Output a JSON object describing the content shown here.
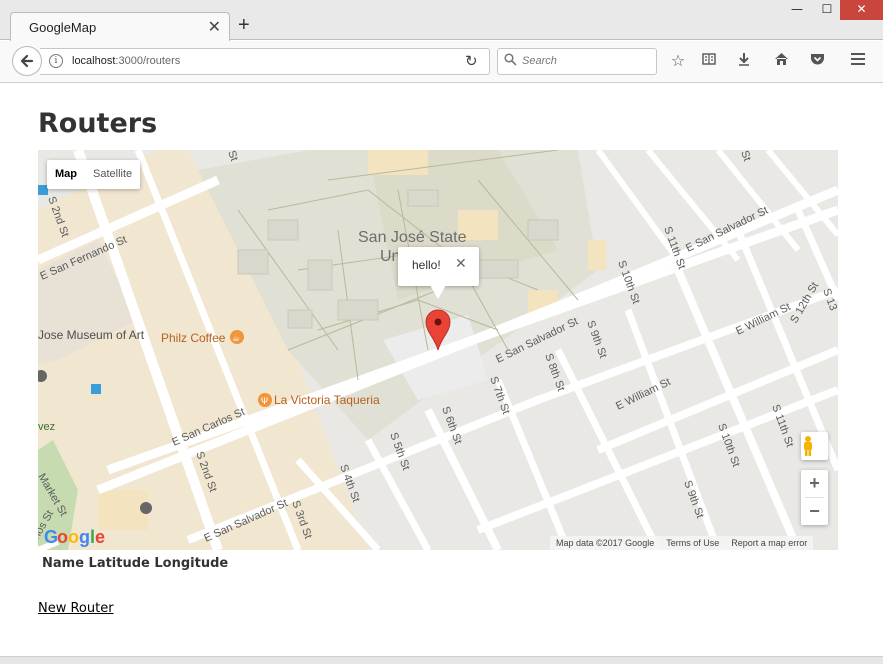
{
  "browser": {
    "tab_title": "GoogleMap",
    "tab_close": "✕",
    "new_tab": "+",
    "url_host": "localhost",
    "url_path": ":3000/routers",
    "search_placeholder": "Search",
    "window_controls": {
      "minimize": "—",
      "maximize": "☐",
      "close": "✕"
    }
  },
  "page": {
    "title": "Routers",
    "table_headers": [
      "Name",
      "Latitude",
      "Longitude"
    ],
    "table_header_text": "Name Latitude Longitude",
    "new_link": "New Router"
  },
  "map": {
    "type_buttons": [
      {
        "label": "Map",
        "active": true
      },
      {
        "label": "Satellite",
        "active": false
      }
    ],
    "info_window": {
      "text": "hello!",
      "close": "✕"
    },
    "zoom": {
      "in": "+",
      "out": "−"
    },
    "attribution": [
      "Map data ©2017 Google",
      "Terms of Use",
      "Report a map error"
    ],
    "google_logo": [
      "G",
      "o",
      "o",
      "g",
      "l",
      "e"
    ],
    "labels": {
      "university": "San José State",
      "university_2": "Un",
      "fernando": "E San Fernando St",
      "museum": "Jose Museum of Art",
      "philz": "Philz Coffee",
      "taqueria": "La Victoria Taqueria",
      "sancarlos": "E San Carlos St",
      "salvador_left": "E San Salvador St",
      "salvador_mid": "E San Salvador St",
      "salvador_right": "E San Salvador St",
      "william_mid": "E William St",
      "william_right": "E William St",
      "s2nd_a": "S 2nd St",
      "s2nd_b": "S 2nd St",
      "s3rd": "S 3rd St",
      "s4th": "S 4th St",
      "s5th": "S 5th St",
      "s6th": "S 6th St",
      "s7th": "S 7th St",
      "s8th": "S 8th St",
      "s9th_a": "S 9th St",
      "s9th_b": "S 9th St",
      "s10th_a": "S 10th St",
      "s10th_b": "S 10th St",
      "s11th_a": "S 11th St",
      "s11th_b": "S 11th St",
      "s12th": "S 12th St",
      "s13": "S 13",
      "st_top1": "St",
      "st_top2": "St",
      "market": "Market St",
      "chavez": "vez",
      "carlos_left": "rlos St",
      "s_top_right": "th St"
    },
    "colors": {
      "campus": "#e4e3d8",
      "road": "#ffffff",
      "block": "#e8e7e4",
      "tan": "#f3e6cc",
      "marker": "#e94335"
    }
  }
}
